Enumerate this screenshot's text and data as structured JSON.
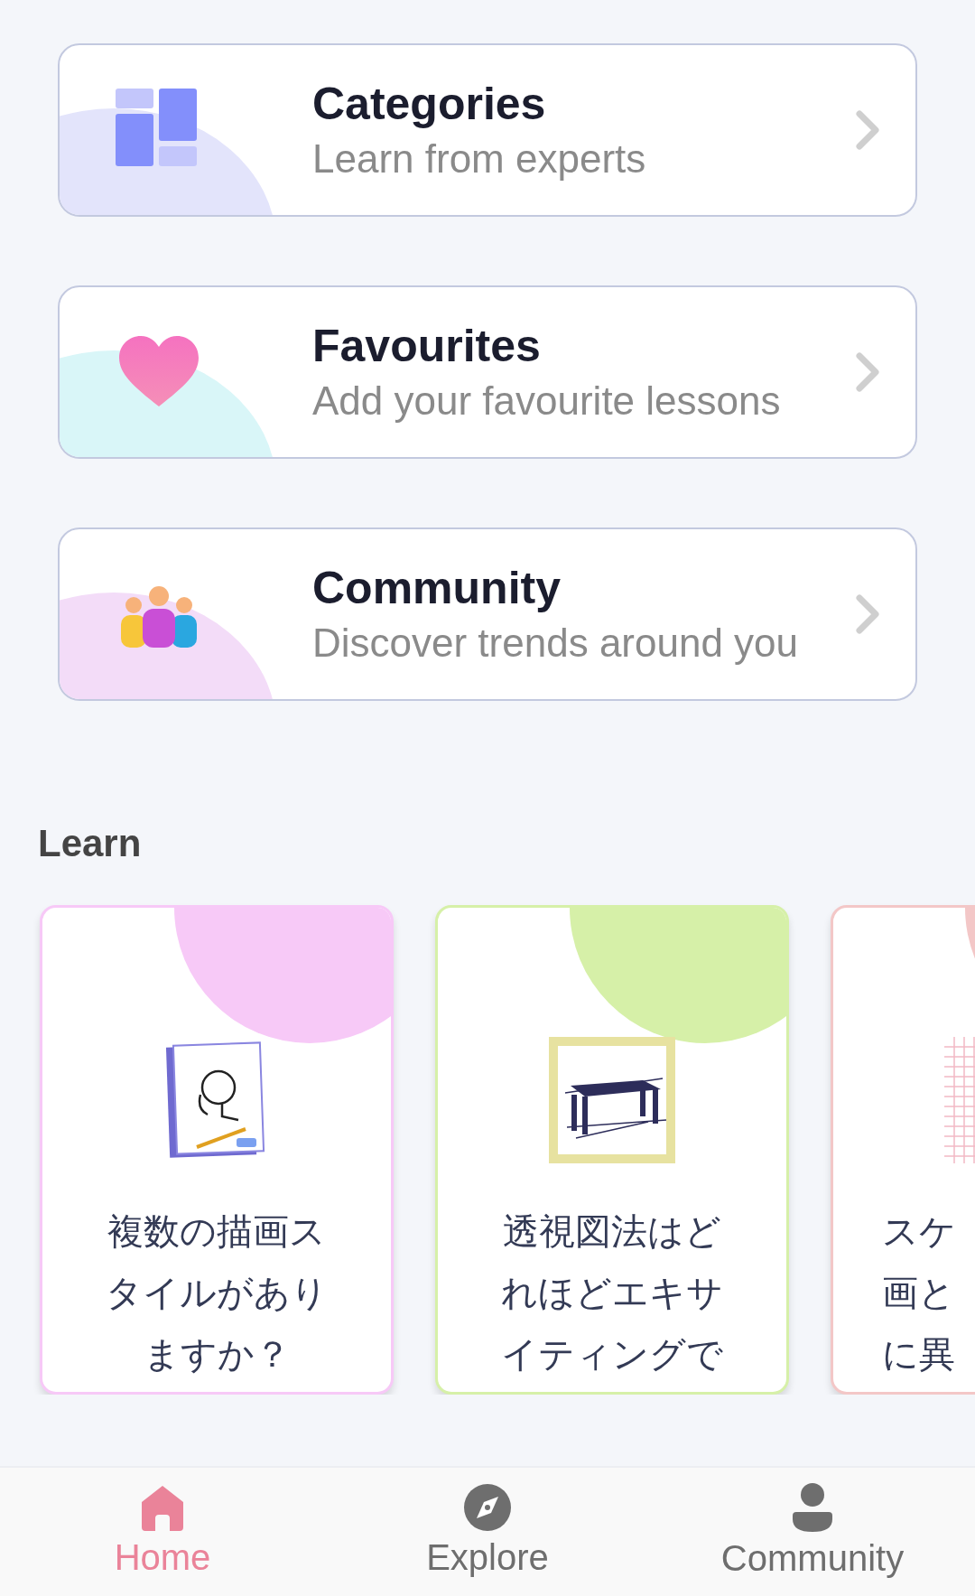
{
  "menu_cards": [
    {
      "kind": "grid",
      "title": "Categories",
      "subtitle": "Learn from experts",
      "color": "#e3e4fb"
    },
    {
      "kind": "heart",
      "title": "Favourites",
      "subtitle": "Add your favourite lessons",
      "color": "#d9f6f8"
    },
    {
      "kind": "people",
      "title": "Community",
      "subtitle": "Discover trends around you",
      "color": "#f3dcf8"
    }
  ],
  "learn": {
    "heading": "Learn",
    "lessons": [
      {
        "kind": "sketchbook",
        "lines": [
          "複数の描画ス",
          "タイルがあり",
          "ますか？"
        ],
        "color": "#f7c9f7"
      },
      {
        "kind": "perspective",
        "lines": [
          "透視図法はど",
          "れほどエキサ",
          "イティングで"
        ],
        "color": "#d6f0a8"
      },
      {
        "kind": "grid-paper",
        "lines": [
          "スケ",
          "画と",
          "に異"
        ],
        "color": "#f3c7c7"
      }
    ]
  },
  "bottom_nav": [
    {
      "kind": "home",
      "label": "Home",
      "selected": true
    },
    {
      "kind": "explore",
      "label": "Explore",
      "selected": false
    },
    {
      "kind": "profile",
      "label": "Community",
      "selected": false
    }
  ]
}
